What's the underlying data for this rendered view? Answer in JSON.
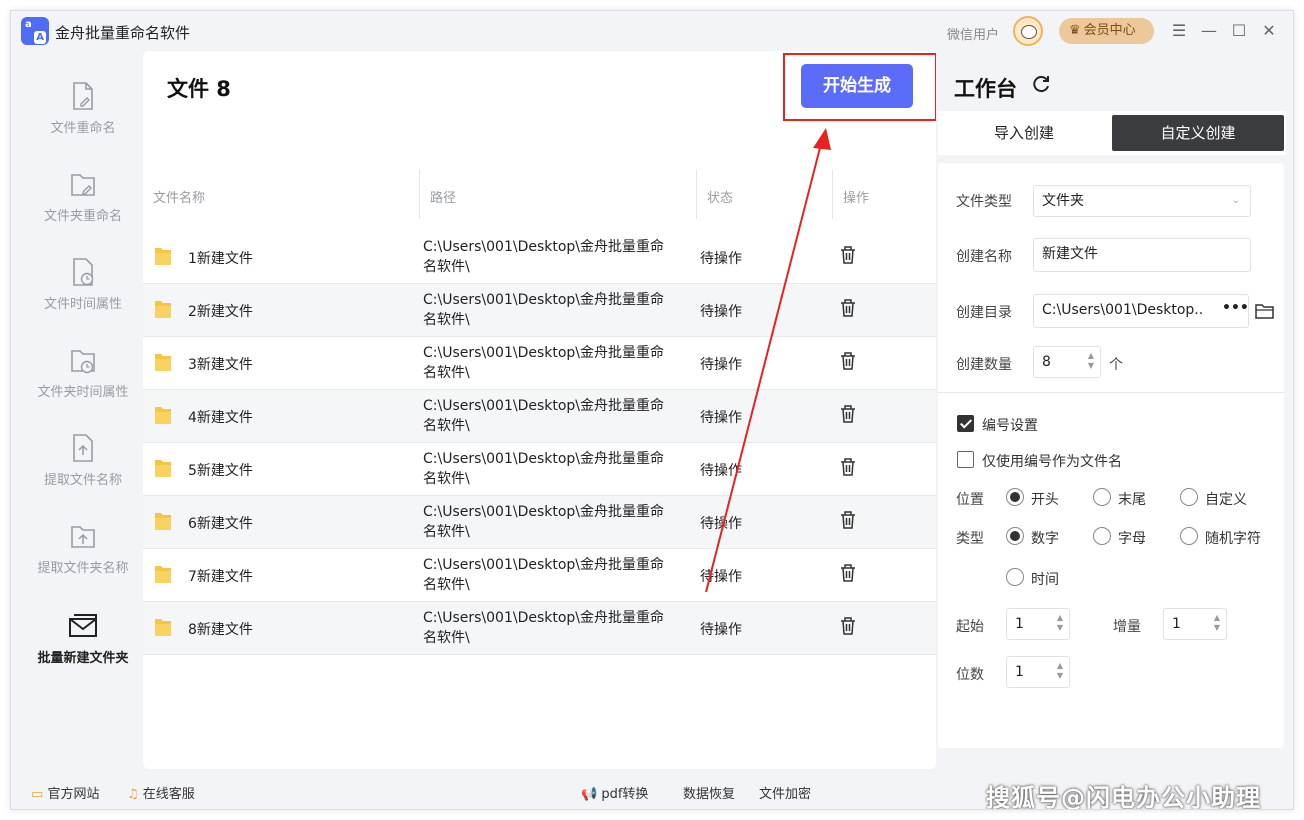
{
  "app": {
    "title": "金舟批量重命名软件",
    "logo_text_top": "a",
    "logo_text_bottom": "A",
    "user_name": "微信用户",
    "member_button": "会员中心",
    "window_controls": [
      "menu-icon",
      "minimize-icon",
      "maximize-icon",
      "close-icon"
    ]
  },
  "sidebar": {
    "items": [
      {
        "label": "文件重命名",
        "icon": "file-edit-icon",
        "active": false
      },
      {
        "label": "文件夹重命名",
        "icon": "folder-edit-icon",
        "active": false
      },
      {
        "label": "文件时间属性",
        "icon": "file-clock-icon",
        "active": false
      },
      {
        "label": "文件夹时间属性",
        "icon": "folder-clock-icon",
        "active": false
      },
      {
        "label": "提取文件名称",
        "icon": "file-upload-icon",
        "active": false
      },
      {
        "label": "提取文件夹名称",
        "icon": "folder-upload-icon",
        "active": false
      },
      {
        "label": "批量新建文件夹",
        "icon": "envelope-icon",
        "active": true
      }
    ]
  },
  "main": {
    "title": "文件 8",
    "start_button": "开始生成",
    "columns": [
      "文件名称",
      "路径",
      "状态",
      "操作"
    ],
    "rows": [
      {
        "name": "1新建文件",
        "path": "C:\\Users\\001\\Desktop\\金舟批量重命名软件\\",
        "status": "待操作"
      },
      {
        "name": "2新建文件",
        "path": "C:\\Users\\001\\Desktop\\金舟批量重命名软件\\",
        "status": "待操作"
      },
      {
        "name": "3新建文件",
        "path": "C:\\Users\\001\\Desktop\\金舟批量重命名软件\\",
        "status": "待操作"
      },
      {
        "name": "4新建文件",
        "path": "C:\\Users\\001\\Desktop\\金舟批量重命名软件\\",
        "status": "待操作"
      },
      {
        "name": "5新建文件",
        "path": "C:\\Users\\001\\Desktop\\金舟批量重命名软件\\",
        "status": "待操作"
      },
      {
        "name": "6新建文件",
        "path": "C:\\Users\\001\\Desktop\\金舟批量重命名软件\\",
        "status": "待操作"
      },
      {
        "name": "7新建文件",
        "path": "C:\\Users\\001\\Desktop\\金舟批量重命名软件\\",
        "status": "待操作"
      },
      {
        "name": "8新建文件",
        "path": "C:\\Users\\001\\Desktop\\金舟批量重命名软件\\",
        "status": "待操作"
      }
    ]
  },
  "workspace": {
    "title": "工作台",
    "tabs": [
      {
        "label": "导入创建",
        "active": false
      },
      {
        "label": "自定义创建",
        "active": true
      }
    ],
    "file_type_label": "文件类型",
    "file_type_value": "文件夹",
    "create_name_label": "创建名称",
    "create_name_value": "新建文件",
    "create_dir_label": "创建目录",
    "create_dir_value": "C:\\Users\\001\\Desktop..",
    "create_dir_more": "•••",
    "create_count_label": "创建数量",
    "create_count_value": "8",
    "create_count_unit": "个",
    "numbering_label": "编号设置",
    "numbering_checked": true,
    "only_number_label": "仅使用编号作为文件名",
    "only_number_checked": false,
    "position_label": "位置",
    "position_options": [
      "开头",
      "末尾",
      "自定义"
    ],
    "position_selected": "开头",
    "type_label": "类型",
    "type_options": [
      "数字",
      "字母",
      "随机字符",
      "时间"
    ],
    "type_selected": "数字",
    "start_label": "起始",
    "start_value": "1",
    "increment_label": "增量",
    "increment_value": "1",
    "digits_label": "位数",
    "digits_value": "1"
  },
  "footer": {
    "website": "官方网站",
    "service": "在线客服",
    "pdf": "pdf转换",
    "recovery": "数据恢复",
    "encrypt": "文件加密",
    "watermark": "搜狐号@闪电办公小助理"
  },
  "colors": {
    "accent": "#5b6df8",
    "annotation_red": "#e8231f",
    "active_tab": "#3a3c40",
    "member_gold": "#ecc89a"
  }
}
